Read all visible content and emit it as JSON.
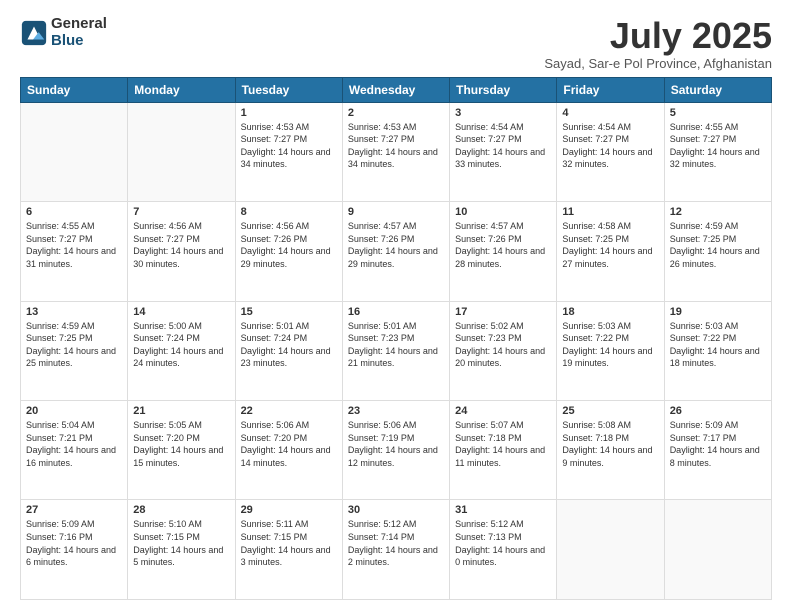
{
  "logo": {
    "general": "General",
    "blue": "Blue"
  },
  "header": {
    "month": "July 2025",
    "location": "Sayad, Sar-e Pol Province, Afghanistan"
  },
  "weekdays": [
    "Sunday",
    "Monday",
    "Tuesday",
    "Wednesday",
    "Thursday",
    "Friday",
    "Saturday"
  ],
  "weeks": [
    [
      {
        "day": "",
        "info": ""
      },
      {
        "day": "",
        "info": ""
      },
      {
        "day": "1",
        "info": "Sunrise: 4:53 AM\nSunset: 7:27 PM\nDaylight: 14 hours and 34 minutes."
      },
      {
        "day": "2",
        "info": "Sunrise: 4:53 AM\nSunset: 7:27 PM\nDaylight: 14 hours and 34 minutes."
      },
      {
        "day": "3",
        "info": "Sunrise: 4:54 AM\nSunset: 7:27 PM\nDaylight: 14 hours and 33 minutes."
      },
      {
        "day": "4",
        "info": "Sunrise: 4:54 AM\nSunset: 7:27 PM\nDaylight: 14 hours and 32 minutes."
      },
      {
        "day": "5",
        "info": "Sunrise: 4:55 AM\nSunset: 7:27 PM\nDaylight: 14 hours and 32 minutes."
      }
    ],
    [
      {
        "day": "6",
        "info": "Sunrise: 4:55 AM\nSunset: 7:27 PM\nDaylight: 14 hours and 31 minutes."
      },
      {
        "day": "7",
        "info": "Sunrise: 4:56 AM\nSunset: 7:27 PM\nDaylight: 14 hours and 30 minutes."
      },
      {
        "day": "8",
        "info": "Sunrise: 4:56 AM\nSunset: 7:26 PM\nDaylight: 14 hours and 29 minutes."
      },
      {
        "day": "9",
        "info": "Sunrise: 4:57 AM\nSunset: 7:26 PM\nDaylight: 14 hours and 29 minutes."
      },
      {
        "day": "10",
        "info": "Sunrise: 4:57 AM\nSunset: 7:26 PM\nDaylight: 14 hours and 28 minutes."
      },
      {
        "day": "11",
        "info": "Sunrise: 4:58 AM\nSunset: 7:25 PM\nDaylight: 14 hours and 27 minutes."
      },
      {
        "day": "12",
        "info": "Sunrise: 4:59 AM\nSunset: 7:25 PM\nDaylight: 14 hours and 26 minutes."
      }
    ],
    [
      {
        "day": "13",
        "info": "Sunrise: 4:59 AM\nSunset: 7:25 PM\nDaylight: 14 hours and 25 minutes."
      },
      {
        "day": "14",
        "info": "Sunrise: 5:00 AM\nSunset: 7:24 PM\nDaylight: 14 hours and 24 minutes."
      },
      {
        "day": "15",
        "info": "Sunrise: 5:01 AM\nSunset: 7:24 PM\nDaylight: 14 hours and 23 minutes."
      },
      {
        "day": "16",
        "info": "Sunrise: 5:01 AM\nSunset: 7:23 PM\nDaylight: 14 hours and 21 minutes."
      },
      {
        "day": "17",
        "info": "Sunrise: 5:02 AM\nSunset: 7:23 PM\nDaylight: 14 hours and 20 minutes."
      },
      {
        "day": "18",
        "info": "Sunrise: 5:03 AM\nSunset: 7:22 PM\nDaylight: 14 hours and 19 minutes."
      },
      {
        "day": "19",
        "info": "Sunrise: 5:03 AM\nSunset: 7:22 PM\nDaylight: 14 hours and 18 minutes."
      }
    ],
    [
      {
        "day": "20",
        "info": "Sunrise: 5:04 AM\nSunset: 7:21 PM\nDaylight: 14 hours and 16 minutes."
      },
      {
        "day": "21",
        "info": "Sunrise: 5:05 AM\nSunset: 7:20 PM\nDaylight: 14 hours and 15 minutes."
      },
      {
        "day": "22",
        "info": "Sunrise: 5:06 AM\nSunset: 7:20 PM\nDaylight: 14 hours and 14 minutes."
      },
      {
        "day": "23",
        "info": "Sunrise: 5:06 AM\nSunset: 7:19 PM\nDaylight: 14 hours and 12 minutes."
      },
      {
        "day": "24",
        "info": "Sunrise: 5:07 AM\nSunset: 7:18 PM\nDaylight: 14 hours and 11 minutes."
      },
      {
        "day": "25",
        "info": "Sunrise: 5:08 AM\nSunset: 7:18 PM\nDaylight: 14 hours and 9 minutes."
      },
      {
        "day": "26",
        "info": "Sunrise: 5:09 AM\nSunset: 7:17 PM\nDaylight: 14 hours and 8 minutes."
      }
    ],
    [
      {
        "day": "27",
        "info": "Sunrise: 5:09 AM\nSunset: 7:16 PM\nDaylight: 14 hours and 6 minutes."
      },
      {
        "day": "28",
        "info": "Sunrise: 5:10 AM\nSunset: 7:15 PM\nDaylight: 14 hours and 5 minutes."
      },
      {
        "day": "29",
        "info": "Sunrise: 5:11 AM\nSunset: 7:15 PM\nDaylight: 14 hours and 3 minutes."
      },
      {
        "day": "30",
        "info": "Sunrise: 5:12 AM\nSunset: 7:14 PM\nDaylight: 14 hours and 2 minutes."
      },
      {
        "day": "31",
        "info": "Sunrise: 5:12 AM\nSunset: 7:13 PM\nDaylight: 14 hours and 0 minutes."
      },
      {
        "day": "",
        "info": ""
      },
      {
        "day": "",
        "info": ""
      }
    ]
  ]
}
